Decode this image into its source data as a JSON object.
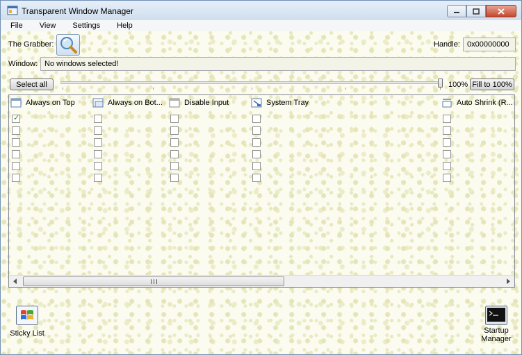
{
  "window": {
    "title": "Transparent Window Manager"
  },
  "menu": [
    "File",
    "View",
    "Settings",
    "Help"
  ],
  "grabber": {
    "label": "The Grabber:"
  },
  "handle": {
    "label": "Handle:",
    "value": "0x00000000"
  },
  "window_field": {
    "label": "Window:",
    "value": "No windows selected!"
  },
  "toolbar": {
    "select_all_label": "Select all",
    "opacity_value": 100,
    "opacity_text": "100%",
    "fill_label": "Fill to 100%"
  },
  "columns": [
    {
      "label": "Always on Top",
      "icon": "window-icon"
    },
    {
      "label": "Always on Bot...",
      "icon": "window-icon"
    },
    {
      "label": "Disable Input",
      "icon": "window-icon"
    },
    {
      "label": "System Tray",
      "icon": "tray-icon"
    },
    {
      "label": "Auto Shrink (R...",
      "icon": "shrink-icon"
    }
  ],
  "rows": [
    [
      true,
      false,
      false,
      false,
      false
    ],
    [
      false,
      false,
      false,
      false,
      false
    ],
    [
      false,
      false,
      false,
      false,
      false
    ],
    [
      false,
      false,
      false,
      false,
      false
    ],
    [
      false,
      false,
      false,
      false,
      false
    ],
    [
      false,
      false,
      false,
      false,
      false
    ]
  ],
  "bottom": {
    "sticky_label": "Sticky List",
    "startup_line1": "Startup",
    "startup_line2": "Manager"
  },
  "colors": {
    "accent": "#6f8fb5",
    "background": "#fbfbf0"
  }
}
